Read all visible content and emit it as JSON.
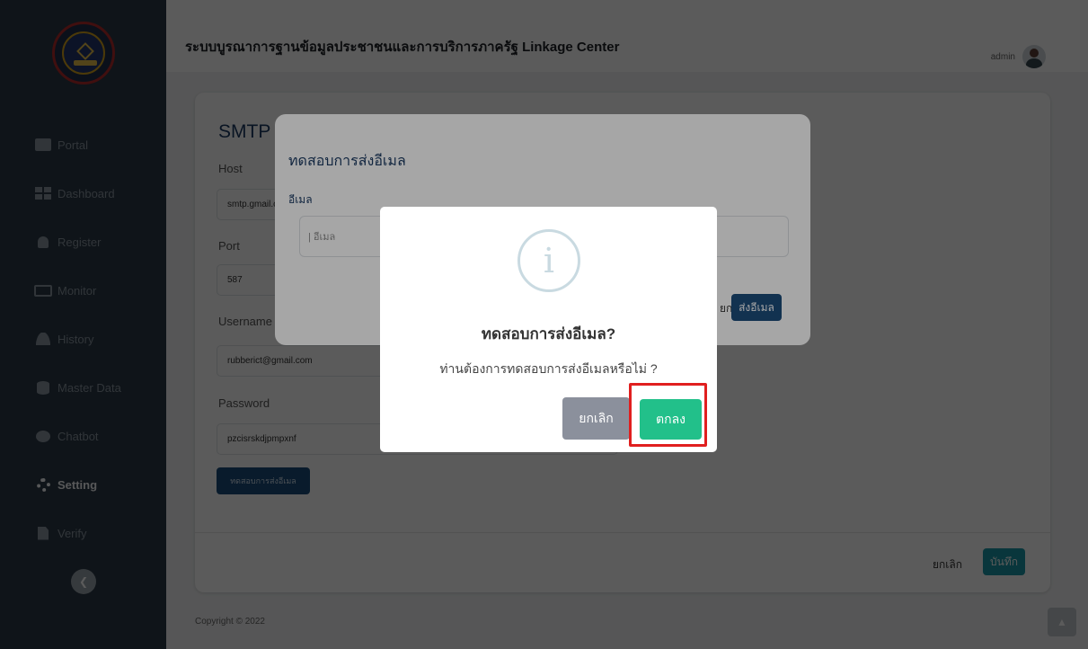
{
  "header": {
    "title": "ระบบบูรณาการฐานข้อมูลประชาชนและการบริการภาครัฐ Linkage Center",
    "user_name": "admin"
  },
  "sidebar": {
    "items": [
      {
        "label": "Portal",
        "icon": "monitor-window-icon",
        "active": false
      },
      {
        "label": "Dashboard",
        "icon": "grid-icon",
        "active": false
      },
      {
        "label": "Register",
        "icon": "bell-icon",
        "active": false
      },
      {
        "label": "Monitor",
        "icon": "monitor-icon",
        "active": false
      },
      {
        "label": "History",
        "icon": "user-icon",
        "active": false
      },
      {
        "label": "Master Data",
        "icon": "database-icon",
        "active": false
      },
      {
        "label": "Chatbot",
        "icon": "chat-icon",
        "active": false
      },
      {
        "label": "Setting",
        "icon": "gear-icon",
        "active": true
      },
      {
        "label": "Verify",
        "icon": "file-icon",
        "active": false
      }
    ]
  },
  "smtp": {
    "title": "SMTP",
    "host_label": "Host",
    "host_value": "smtp.gmail.com",
    "port_label": "Port",
    "port_value": "587",
    "username_label": "Username",
    "username_value": "rubberict@gmail.com",
    "password_label": "Password",
    "password_value": "pzcisrskdjpmpxnf",
    "test_button": "ทดสอบการส่งอีเมล",
    "cancel": "ยกเลิก",
    "save": "บันทึก"
  },
  "footer": {
    "copyright": "Copyright © 2022"
  },
  "email_modal": {
    "title": "ทดสอบการส่งอีเมล",
    "email_label": "อีเมล",
    "email_placeholder": "อีเมล",
    "cancel": "ยกเลิก",
    "send": "ส่งอีเมล"
  },
  "confirm_dialog": {
    "icon": "info-icon",
    "title": "ทดสอบการส่งอีเมล?",
    "text": "ท่านต้องการทดสอบการส่งอีเมลหรือไม่ ?",
    "cancel": "ยกเลิก",
    "ok": "ตกลง"
  },
  "colors": {
    "sidebar": "#2b3a47",
    "primary": "#1d4d7c",
    "teal": "#1d9aa8",
    "confirm_green": "#22c08a",
    "highlight_red": "#e01f1f"
  }
}
